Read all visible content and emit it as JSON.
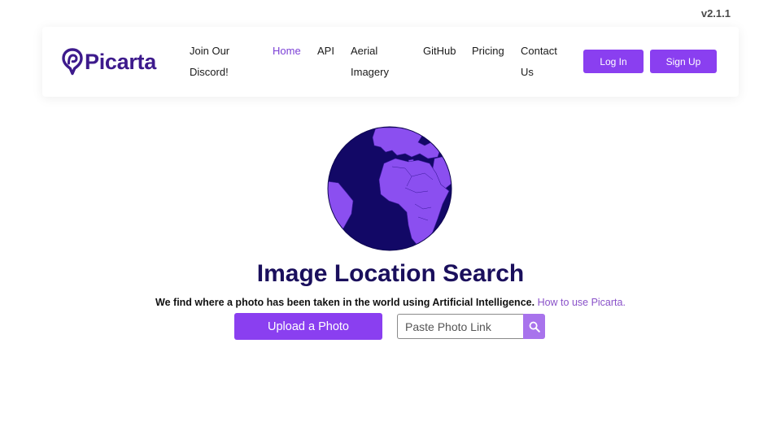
{
  "version": "v2.1.1",
  "logo": {
    "text": "Picarta"
  },
  "nav": {
    "discord_line1": "Join Our",
    "discord_line2": "Discord!",
    "home": "Home",
    "api": "API",
    "aerial_line1": "Aerial",
    "aerial_line2": "Imagery",
    "github": "GitHub",
    "pricing": "Pricing",
    "contact_line1": "Contact",
    "contact_line2": "Us",
    "login": "Log In",
    "signup": "Sign Up"
  },
  "hero": {
    "globe_icon": "globe-icon",
    "title": "Image Location Search",
    "subtitle": "We find where a photo has been taken in the world using Artificial Intelligence.",
    "howto_link": "How to use Picarta.",
    "upload_button": "Upload a Photo",
    "link_placeholder": "Paste Photo Link",
    "search_icon": "search-icon"
  },
  "colors": {
    "brand_purple": "#8a3ff0",
    "logo_navy": "#3d1a8c",
    "title_navy": "#1a0f5c",
    "active_link": "#7b3fd6",
    "search_button": "#a873ec",
    "globe_ocean": "#120866",
    "globe_land": "#8b4ff0"
  }
}
